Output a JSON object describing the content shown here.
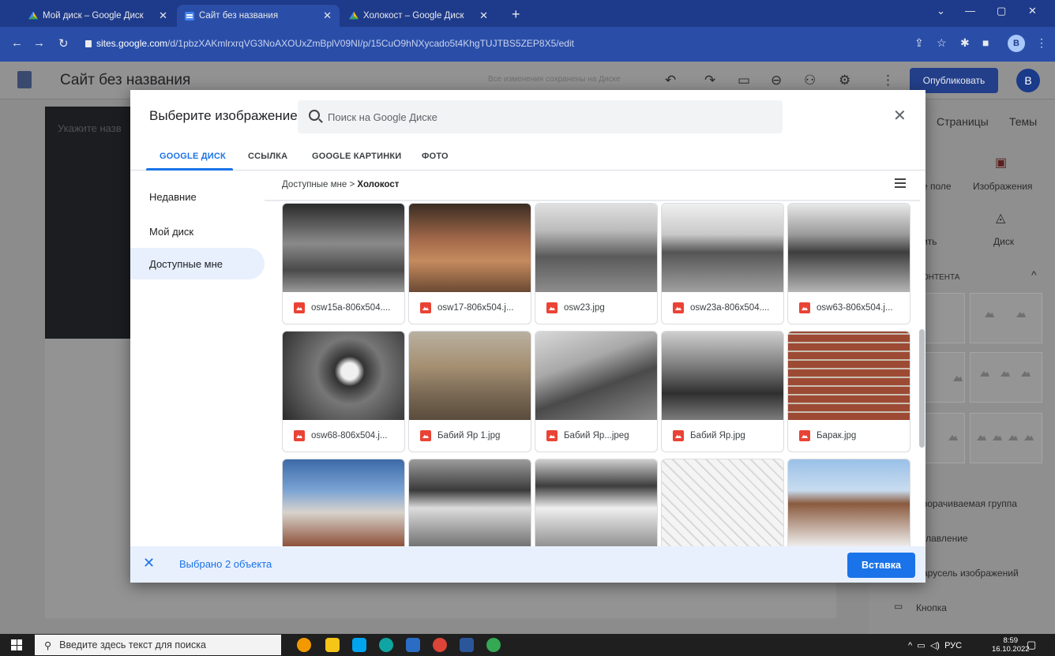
{
  "browser": {
    "tabs": [
      {
        "title": "Мой диск – Google Диск",
        "favicon": "drive-icon",
        "active": false
      },
      {
        "title": "Сайт без названия",
        "favicon": "sites-icon",
        "active": true
      },
      {
        "title": "Холокост – Google Диск",
        "favicon": "drive-icon",
        "active": false
      }
    ],
    "url_host": "sites.google.com",
    "url_path": "/d/1pbzXAKmlrxrqVG3NoAXOUxZmBplV09NI/p/15CuO9hNXycado5t4KhgTUJTBS5ZEP8X5/edit",
    "profile_letter": "B"
  },
  "editor": {
    "site_title": "Сайт без названия",
    "saved_status": "Все изменения сохранены на Диске",
    "publish_label": "Опубликовать",
    "avatar_letter": "B",
    "hero_placeholder": "Укажите назв",
    "side_tabs": [
      "Страницы",
      "Темы"
    ],
    "insert_items": {
      "textbox": "е поле",
      "images": "Изображения",
      "embed": "ить",
      "drive": "Диск",
      "layouts_header": "ОНТЕНТА",
      "collapsible": "ворачиваемая группа",
      "toc": "главление",
      "carousel": "арусель изображений",
      "button": "Кнопка"
    }
  },
  "dialog": {
    "title": "Выберите изображение",
    "search_placeholder": "Поиск на Google Диске",
    "tabs": [
      "GOOGLE ДИСК",
      "ССЫЛКА",
      "GOOGLE КАРТИНКИ",
      "ФОТО"
    ],
    "active_tab": 0,
    "nav": [
      "Недавние",
      "Мой диск",
      "Доступные мне"
    ],
    "active_nav": 2,
    "breadcrumb": {
      "parent": "Доступные мне",
      "separator": ">",
      "current": "Холокост"
    },
    "files": [
      {
        "name": "osw15a-806x504....",
        "thumb": "bw-corridor"
      },
      {
        "name": "osw17-806x504.j...",
        "thumb": "brick-ovens"
      },
      {
        "name": "osw23.jpg",
        "thumb": "bw-barracks"
      },
      {
        "name": "osw23a-806x504....",
        "thumb": "bw-fence"
      },
      {
        "name": "osw63-806x504.j...",
        "thumb": "bw-yard"
      },
      {
        "name": "osw68-806x504.j...",
        "thumb": "bw-insulators"
      },
      {
        "name": "Бабий Яр 1.jpg",
        "thumb": "ravine-color"
      },
      {
        "name": "Бабий Яр...jpeg",
        "thumb": "bw-ravine"
      },
      {
        "name": "Бабий Яр.jpg",
        "thumb": "bw-crowd"
      },
      {
        "name": "Барак.jpg",
        "thumb": "brick-wall"
      },
      {
        "name": "",
        "thumb": "gate-sky"
      },
      {
        "name": "",
        "thumb": "bw-rail-gate"
      },
      {
        "name": "",
        "thumb": "bw-rail-snow"
      },
      {
        "name": "",
        "thumb": "plan-drawing"
      },
      {
        "name": "",
        "thumb": "snow-chimney"
      }
    ],
    "selection_text": "Выбрано 2 объекта",
    "insert_label": "Вставка"
  },
  "taskbar": {
    "search_placeholder": "Введите здесь текст для поиска",
    "lang": "РУС",
    "time": "8:59",
    "date": "16.10.2022"
  },
  "colors": {
    "accent": "#1a73e8",
    "selected_nav_bg": "#e8f0fe",
    "chrome_tab_bar": "#1e3a8a",
    "file_icon": "#ea4335"
  }
}
